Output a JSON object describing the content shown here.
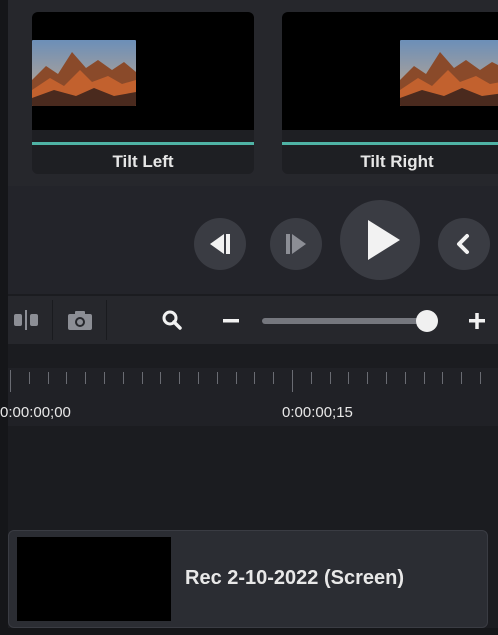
{
  "transitions": {
    "items": [
      {
        "label": "Tilt Left"
      },
      {
        "label": "Tilt Right"
      }
    ]
  },
  "playback": {
    "buttons": [
      "step-back",
      "step-forward",
      "play",
      "previous"
    ]
  },
  "toolbar": {
    "tools": [
      "split-icon",
      "camera-icon",
      "search-icon",
      "minus-icon",
      "plus-icon"
    ],
    "zoom_level": 0.95
  },
  "timeline": {
    "timecodes": [
      "0:00:00;00",
      "0:00:00;15"
    ]
  },
  "clip": {
    "name": "Rec 2-10-2022 (Screen)"
  },
  "colors": {
    "accent": "#4fb3a5",
    "panel": "#26272c",
    "background": "#1b1c20"
  }
}
